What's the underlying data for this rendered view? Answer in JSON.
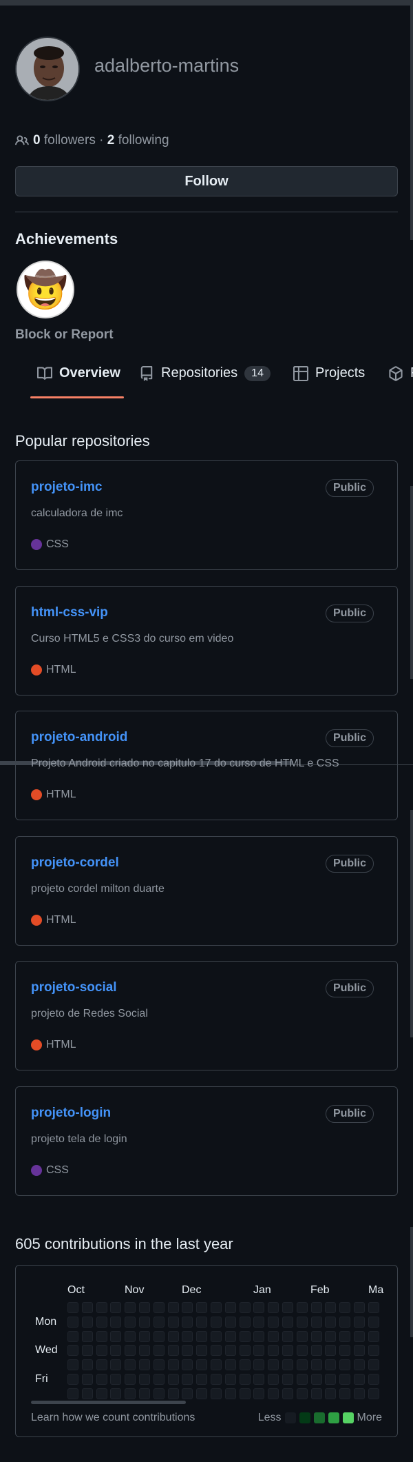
{
  "profile": {
    "username": "adalberto-martins",
    "followers_count": "0",
    "followers_label": "followers",
    "separator": "·",
    "following_count": "2",
    "following_label": "following",
    "follow_button": "Follow"
  },
  "achievements": {
    "title": "Achievements",
    "badge_icon": "cowboy-face-badge"
  },
  "block_report": "Block or Report",
  "tabs": [
    {
      "label": "Overview",
      "icon": "book-icon",
      "selected": true
    },
    {
      "label": "Repositories",
      "icon": "repo-icon",
      "count": "14"
    },
    {
      "label": "Projects",
      "icon": "table-icon"
    },
    {
      "label": "P",
      "icon": "package-icon"
    }
  ],
  "popular": {
    "title": "Popular repositories",
    "repos": [
      {
        "name": "projeto-imc",
        "visibility": "Public",
        "description": "calculadora de imc",
        "language": "CSS",
        "language_color": "#663399"
      },
      {
        "name": "html-css-vip",
        "visibility": "Public",
        "description": "Curso HTML5 e CSS3 do curso em video",
        "language": "HTML",
        "language_color": "#e34c26"
      },
      {
        "name": "projeto-android",
        "visibility": "Public",
        "description": "Projeto Android criado no capitulo 17 do curso de HTML e CSS",
        "language": "HTML",
        "language_color": "#e34c26"
      },
      {
        "name": "projeto-cordel",
        "visibility": "Public",
        "description": "projeto cordel milton duarte",
        "language": "HTML",
        "language_color": "#e34c26"
      },
      {
        "name": "projeto-social",
        "visibility": "Public",
        "description": "projeto de Redes Social",
        "language": "HTML",
        "language_color": "#e34c26"
      },
      {
        "name": "projeto-login",
        "visibility": "Public",
        "description": "projeto tela de login",
        "language": "CSS",
        "language_color": "#663399"
      }
    ]
  },
  "contributions": {
    "title": "605 contributions in the last year",
    "months": [
      "Oct",
      "Nov",
      "Dec",
      "Jan",
      "Feb",
      "Ma"
    ],
    "days": [
      "Mon",
      "Wed",
      "Fri"
    ],
    "learn_link": "Learn how we count contributions",
    "legend_less": "Less",
    "legend_more": "More",
    "legend_colors": [
      "#161b22",
      "#033a16",
      "#196c2e",
      "#2ea043",
      "#56d364"
    ]
  }
}
